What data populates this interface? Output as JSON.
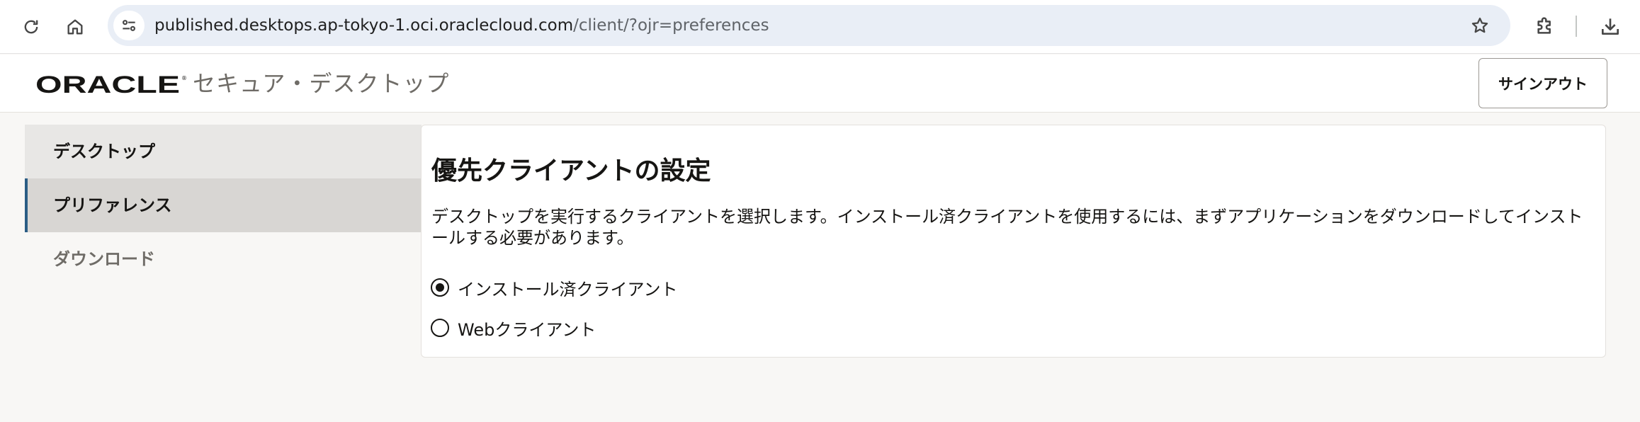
{
  "browser": {
    "url_host": "published.desktops.ap-tokyo-1.oci.oraclecloud.com",
    "url_path": "/client/?ojr=preferences",
    "icons": [
      "reload-icon",
      "home-icon",
      "site-info-icon",
      "star-icon",
      "extensions-icon",
      "download-icon"
    ]
  },
  "header": {
    "logo_text": "ORACLE",
    "app_title": "セキュア・デスクトップ",
    "signout_label": "サインアウト"
  },
  "sidebar": {
    "items": [
      {
        "label": "デスクトップ",
        "state": "default"
      },
      {
        "label": "プリファレンス",
        "state": "active"
      },
      {
        "label": "ダウンロード",
        "state": "muted"
      }
    ]
  },
  "main": {
    "title": "優先クライアントの設定",
    "description": "デスクトップを実行するクライアントを選択します。インストール済クライアントを使用するには、まずアプリケーションをダウンロードしてインストールする必要があります。",
    "options": [
      {
        "label": "インストール済クライアント",
        "checked": true
      },
      {
        "label": "Webクライアント",
        "checked": false
      }
    ]
  },
  "colors": {
    "accent": "#2b5d85",
    "page_bg": "#f8f7f5",
    "text": "#161513",
    "muted_text": "#6f6c67"
  }
}
